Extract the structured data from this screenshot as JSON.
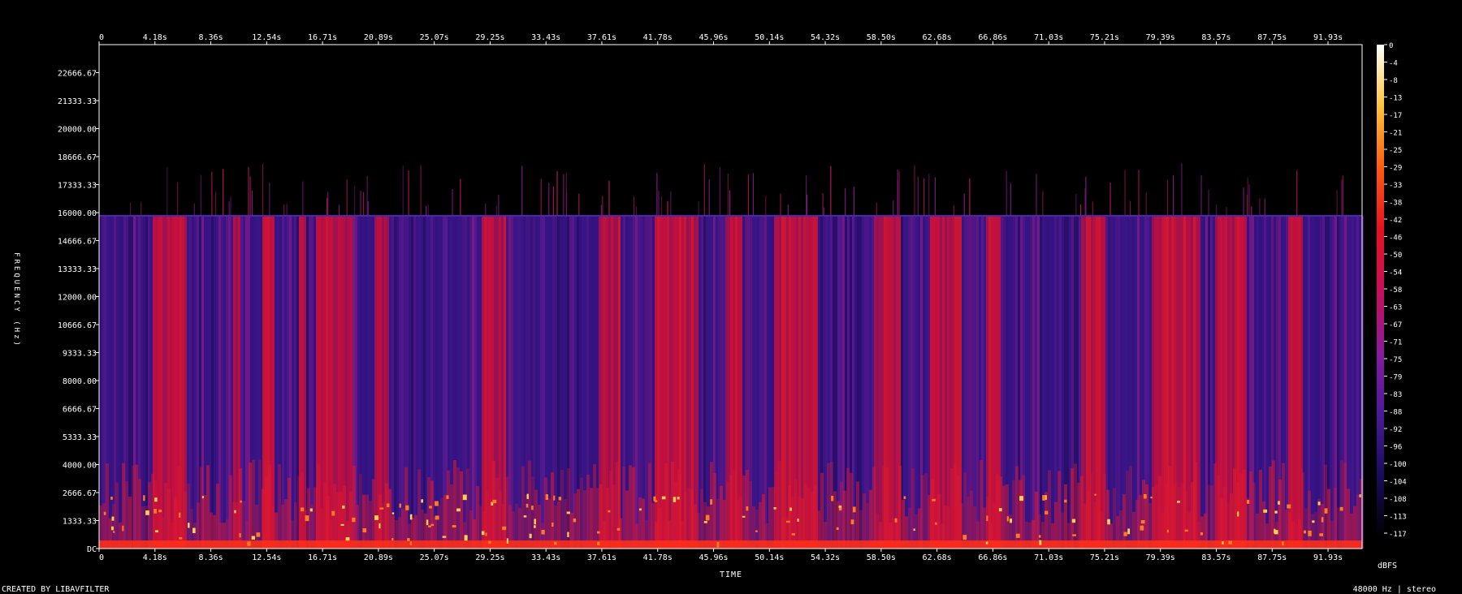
{
  "chart_data": {
    "type": "heatmap",
    "title": "",
    "xlabel": "TIME",
    "ylabel": "FREQUENCY (Hz)",
    "colorbar_label": "dBFS",
    "x_ticks": [
      "0",
      "4.18s",
      "8.36s",
      "12.54s",
      "16.71s",
      "20.89s",
      "25.07s",
      "29.25s",
      "33.43s",
      "37.61s",
      "41.78s",
      "45.96s",
      "50.14s",
      "54.32s",
      "58.50s",
      "62.68s",
      "66.86s",
      "71.03s",
      "75.21s",
      "79.39s",
      "83.57s",
      "87.75s",
      "91.93s"
    ],
    "y_ticks": [
      "22666.67",
      "21333.33",
      "20000.00",
      "18666.67",
      "17333.33",
      "16000.00",
      "14666.67",
      "13333.33",
      "12000.00",
      "10666.67",
      "9333.33",
      "8000.00",
      "6666.67",
      "5333.33",
      "4000.00",
      "2666.67",
      "1333.33",
      "DC"
    ],
    "colorbar_ticks": [
      "0",
      "-4",
      "-8",
      "-13",
      "-17",
      "-21",
      "-25",
      "-29",
      "-33",
      "-38",
      "-42",
      "-46",
      "-50",
      "-54",
      "-58",
      "-63",
      "-67",
      "-71",
      "-75",
      "-79",
      "-83",
      "-88",
      "-92",
      "-96",
      "-100",
      "-104",
      "-108",
      "-113",
      "-117"
    ],
    "duration_s": 95.1,
    "freq_range_hz": [
      0,
      24000
    ],
    "cutoff_hz": 15850,
    "db_range": [
      -120,
      0
    ],
    "colormap": [
      "#000000",
      "#1a0b5c",
      "#4a1a9a",
      "#8a1a9e",
      "#c80f5a",
      "#e81020",
      "#ff5a10",
      "#ffc43a",
      "#ffffff"
    ],
    "bright_segments_s": [
      [
        4.0,
        6.6
      ],
      [
        10.0,
        10.6
      ],
      [
        12.2,
        13.2
      ],
      [
        15.0,
        15.5
      ],
      [
        16.2,
        19.0
      ],
      [
        20.6,
        21.8
      ],
      [
        28.7,
        30.5
      ],
      [
        37.6,
        39.2
      ],
      [
        41.8,
        45.0
      ],
      [
        47.0,
        48.4
      ],
      [
        50.8,
        54.0
      ],
      [
        58.2,
        60.2
      ],
      [
        62.5,
        64.8
      ],
      [
        66.7,
        67.8
      ],
      [
        73.8,
        75.7
      ],
      [
        79.2,
        82.8
      ],
      [
        84.0,
        86.3
      ],
      [
        89.5,
        90.6
      ]
    ]
  },
  "footer": {
    "created_by": "CREATED BY LIBAVFILTER",
    "format": "48000 Hz | stereo"
  }
}
